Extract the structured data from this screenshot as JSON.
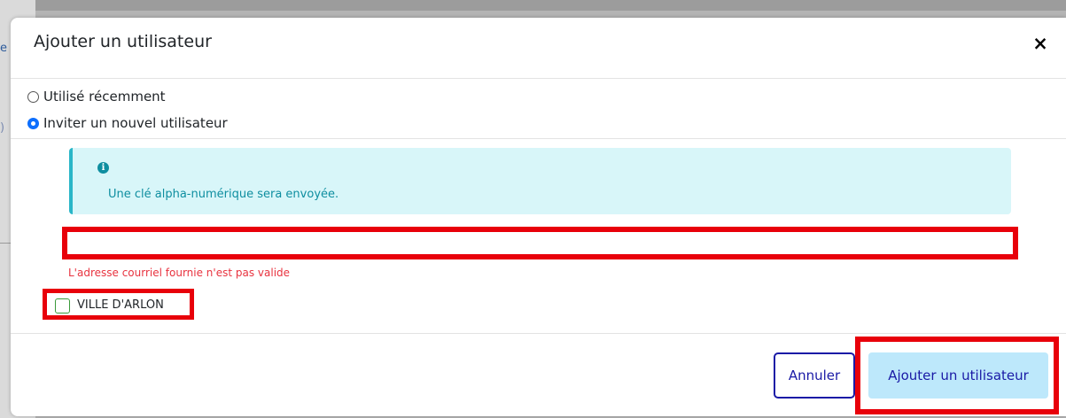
{
  "background": {
    "glyph_top": "e",
    "glyph_mid": ")"
  },
  "modal": {
    "title": "Ajouter un utilisateur",
    "close_icon": "×"
  },
  "radio_options": [
    {
      "label": "Utilisé récemment",
      "checked": false
    },
    {
      "label": "Inviter un nouvel utilisateur",
      "checked": true
    }
  ],
  "info_box": {
    "icon": "info-circle-icon",
    "icon_glyph": "i",
    "message": "Une clé alpha-numérique sera envoyée."
  },
  "email_field": {
    "value": "",
    "placeholder": "",
    "error": "L'adresse courriel fournie n'est pas valide"
  },
  "organization": {
    "label": "VILLE D'ARLON",
    "checked": false
  },
  "footer": {
    "cancel_label": "Annuler",
    "submit_label": "Ajouter un utilisateur"
  },
  "colors": {
    "highlight_red": "#e8000a",
    "info_background": "#d8f6f9",
    "info_accent": "#29b6c8",
    "info_text": "#0e8ea0",
    "error_text": "#e8333f",
    "primary_navy": "#1a1aa6",
    "submit_background": "#bde8fb",
    "radio_checked": "#0d6efd",
    "checkbox_border": "#3a9a3a"
  }
}
